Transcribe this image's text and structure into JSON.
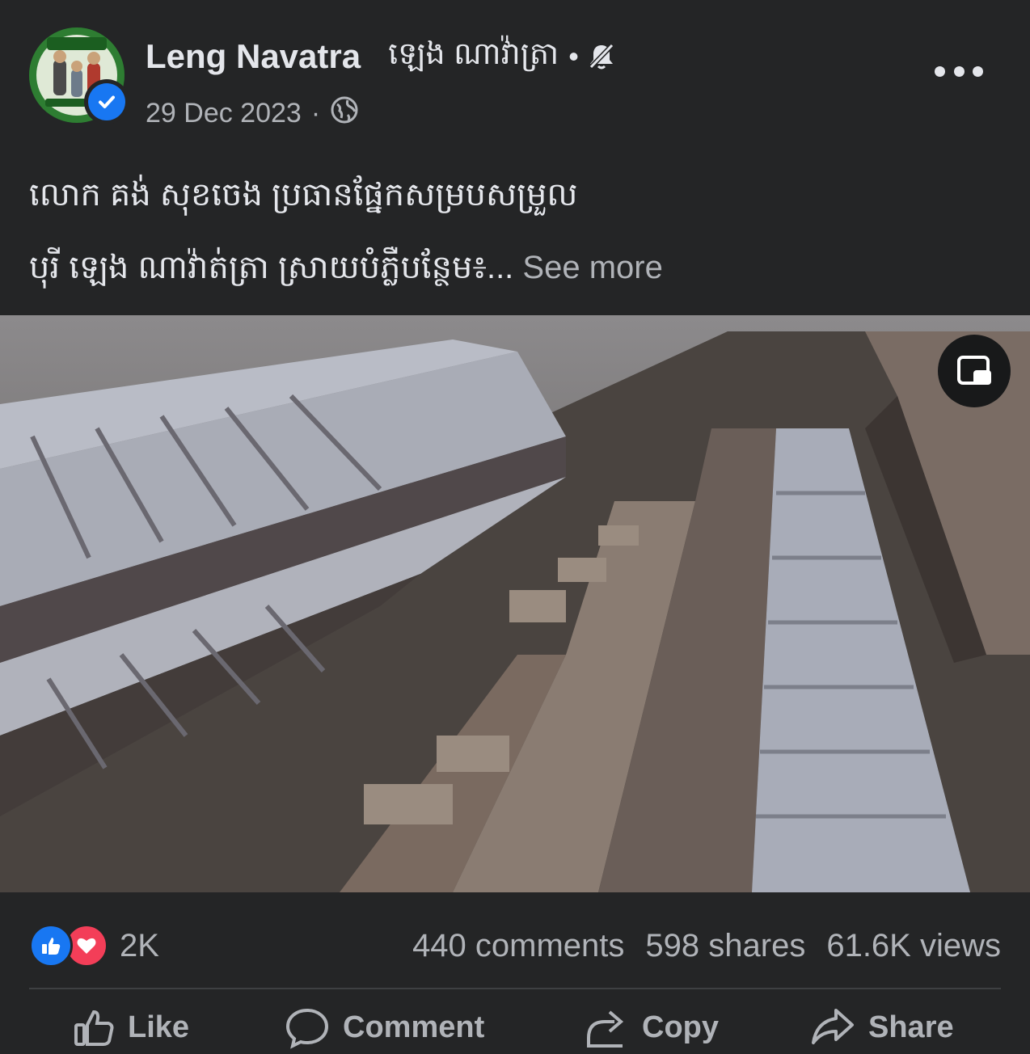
{
  "post": {
    "author": "Leng Navatra",
    "page_name": "ឡេង ណាវ៉ាត្រា",
    "dot": "•",
    "date": "29 Dec 2023",
    "date_sep": "·",
    "caption_line1": "លោក គង់ សុខចេង ប្រធានផ្នែកសម្របសម្រួល",
    "caption_line2": "បុរី ឡេង ណាវ៉ាត់ត្រា ស្រាយបំភ្លឺបន្ថែម៖...",
    "see_more": "See more"
  },
  "stats": {
    "reactions_count": "2K",
    "comments": "440 comments",
    "shares": "598 shares",
    "views": "61.6K views"
  },
  "actions": {
    "like": "Like",
    "comment": "Comment",
    "copy": "Copy",
    "share": "Share"
  },
  "icons": {
    "verified": "verified-badge-icon",
    "muted": "bell-muted-icon",
    "audience": "globe-icon",
    "more": "more-options-icon",
    "pip": "picture-in-picture-icon"
  },
  "colors": {
    "background": "#242526",
    "text_primary": "#e4e6eb",
    "text_secondary": "#b0b3b8",
    "accent_blue": "#1877f2",
    "love_red": "#f33e58"
  }
}
